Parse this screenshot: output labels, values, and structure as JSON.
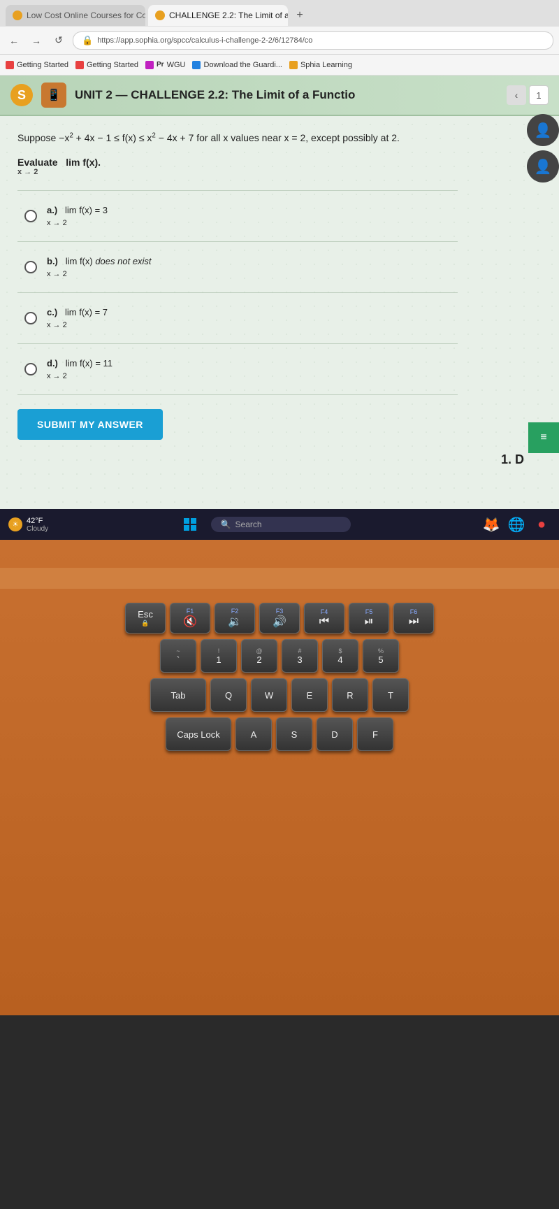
{
  "browser": {
    "tabs": [
      {
        "id": "tab1",
        "label": "Low Cost Online Courses for Co",
        "active": false,
        "favicon_color": "#e8a020"
      },
      {
        "id": "tab2",
        "label": "CHALLENGE 2.2: The Limit of a",
        "active": true,
        "favicon_color": "#e8a020"
      }
    ],
    "new_tab_label": "+",
    "url": "https://app.sophia.org/spcc/calculus-i-challenge-2-2/6/12784/co",
    "nav": {
      "back": "←",
      "forward": "→",
      "reload": "↺"
    },
    "bookmarks": [
      {
        "label": "Getting Started",
        "color": "#e84040"
      },
      {
        "label": "Getting Started",
        "color": "#e84040"
      },
      {
        "label": "WGU",
        "color": "#c020c0"
      },
      {
        "label": "Download the Guardi...",
        "color": "#2080e0"
      },
      {
        "label": "Sphia Learning",
        "color": "#e8a020"
      }
    ]
  },
  "page": {
    "unit_title": "UNIT 2 — CHALLENGE 2.2: The Limit of a Functio",
    "nav_page": "1",
    "question": {
      "premise": "Suppose −x² + 4x − 1 ≤ f(x) ≤ x² − 4x + 7 for all x values near x = 2, except possibly at 2.",
      "task": "Evaluate",
      "limit_notation": "lim f(x).",
      "limit_sub": "x → 2",
      "options": [
        {
          "id": "a",
          "letter": "a.)",
          "label": "lim f(x) = 3",
          "sub": "x → 2"
        },
        {
          "id": "b",
          "letter": "b.)",
          "label": "lim f(x) does not exist",
          "sub": "x → 2"
        },
        {
          "id": "c",
          "letter": "c.)",
          "label": "lim f(x) = 7",
          "sub": "x → 2"
        },
        {
          "id": "d",
          "letter": "d.)",
          "label": "lim f(x) = 11",
          "sub": "x → 2"
        }
      ],
      "submit_label": "SUBMIT MY ANSWER"
    },
    "side_label": "1. D"
  },
  "taskbar": {
    "weather_temp": "42°F",
    "weather_condition": "Cloudy",
    "search_placeholder": "Search"
  },
  "keyboard": {
    "rows": [
      [
        "Esc",
        "F1",
        "F2",
        "F3",
        "F4",
        "F5",
        "F6"
      ],
      [
        "~\n`",
        "!\n1",
        "@\n2",
        "#\n3",
        "$\n4",
        "%\n5"
      ],
      [
        "Tab",
        "Q",
        "W",
        "E",
        "R",
        "T"
      ],
      [
        "Caps Lock",
        "A",
        "S",
        "D",
        "F"
      ]
    ]
  }
}
